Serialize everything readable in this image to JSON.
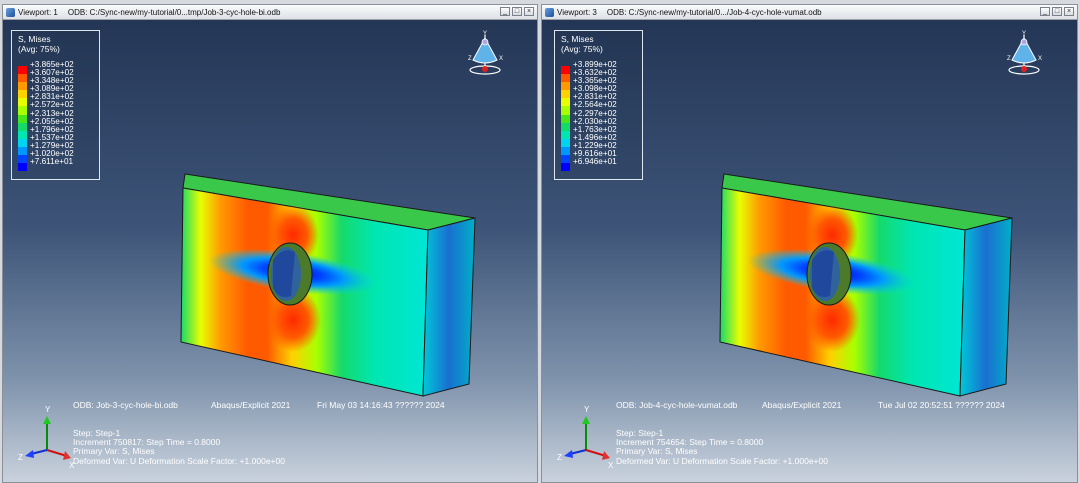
{
  "viewports": [
    {
      "title": "Viewport: 1",
      "odb_path": "ODB: C:/Sync-new/my-tutorial/0...tmp/Job-3-cyc-hole-bi.odb",
      "legend": {
        "title": "S, Mises",
        "avg": "(Avg: 75%)",
        "values": [
          "+3.865e+02",
          "+3.607e+02",
          "+3.348e+02",
          "+3.089e+02",
          "+2.831e+02",
          "+2.572e+02",
          "+2.313e+02",
          "+2.055e+02",
          "+1.796e+02",
          "+1.537e+02",
          "+1.279e+02",
          "+1.020e+02",
          "+7.611e+01"
        ]
      },
      "info": {
        "odb_line": "ODB: Job-3-cyc-hole-bi.odb",
        "solver": "Abaqus/Explicit 2021",
        "date": "Fri May 03 14:16:43 ?????? 2024",
        "step": "Step: Step-1",
        "increment": "Increment    750817: Step Time =   0.8000",
        "primary": "Primary Var: S, Mises",
        "deformed": "Deformed Var: U   Deformation Scale Factor: +1.000e+00"
      }
    },
    {
      "title": "Viewport: 3",
      "odb_path": "ODB: C:/Sync-new/my-tutorial/0.../Job-4-cyc-hole-vumat.odb",
      "legend": {
        "title": "S, Mises",
        "avg": "(Avg: 75%)",
        "values": [
          "+3.899e+02",
          "+3.632e+02",
          "+3.365e+02",
          "+3.098e+02",
          "+2.831e+02",
          "+2.564e+02",
          "+2.297e+02",
          "+2.030e+02",
          "+1.763e+02",
          "+1.496e+02",
          "+1.229e+02",
          "+9.616e+01",
          "+6.946e+01"
        ]
      },
      "info": {
        "odb_line": "ODB: Job-4-cyc-hole-vumat.odb",
        "solver": "Abaqus/Explicit 2021",
        "date": "Tue Jul 02 20:52:51 ?????? 2024",
        "step": "Step: Step-1",
        "increment": "Increment    754654: Step Time =   0.8000",
        "primary": "Primary Var: S, Mises",
        "deformed": "Deformed Var: U   Deformation Scale Factor: +1.000e+00"
      }
    }
  ],
  "legend_colors": [
    "#ff0000",
    "#ff5a00",
    "#ff9a00",
    "#ffd200",
    "#e9ff00",
    "#a8ff00",
    "#46e61a",
    "#16d96b",
    "#00e6b0",
    "#00d4f0",
    "#0098ff",
    "#0046ff",
    "#0000ff"
  ],
  "triad_labels": {
    "x": "X",
    "y": "Y",
    "z": "Z"
  },
  "window_buttons": [
    "_",
    "□",
    "×"
  ]
}
